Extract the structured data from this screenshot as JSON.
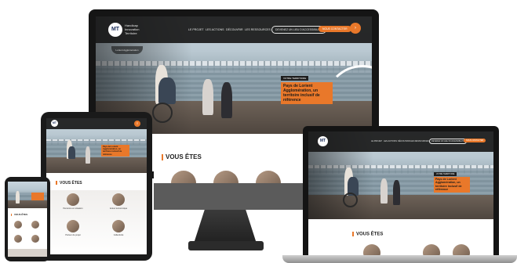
{
  "brand": {
    "logo_mark": "MT",
    "name_lines": [
      "Handicap",
      "Innovation",
      "Territoire"
    ],
    "sublogo": "Lorient Agglomération"
  },
  "nav": {
    "links": [
      "LE PROJET",
      "LES ACTIONS",
      "DÉCOUVRIR",
      "LES RESSOURCES"
    ],
    "outline_button": "DEVENEZ UN LIEU D'ACCESSIBILITÉ",
    "orange_button": "NOUS CONTACTER",
    "round_button_icon": "arrow-right-icon"
  },
  "hero": {
    "badge": "VOTRE TERRITOIRE",
    "headline_lines": [
      "Pays de Lorient",
      "Agglomération, un",
      "territoire inclusif de",
      "référence"
    ]
  },
  "section": {
    "title": "VOUS ÊTES"
  },
  "tablet_cards": [
    {
      "label": "Personne en situation",
      "icon": "person-photo"
    },
    {
      "label": "Acteur économique",
      "icon": "person-photo"
    },
    {
      "label": "Porteur de projet",
      "icon": "person-photo"
    },
    {
      "label": "Collectivité",
      "icon": "person-photo"
    }
  ],
  "phone": {
    "section_title": "VOUS ÊTES"
  },
  "colors": {
    "accent": "#e9782a",
    "dark": "#151515",
    "navy": "#1b2d5a"
  }
}
